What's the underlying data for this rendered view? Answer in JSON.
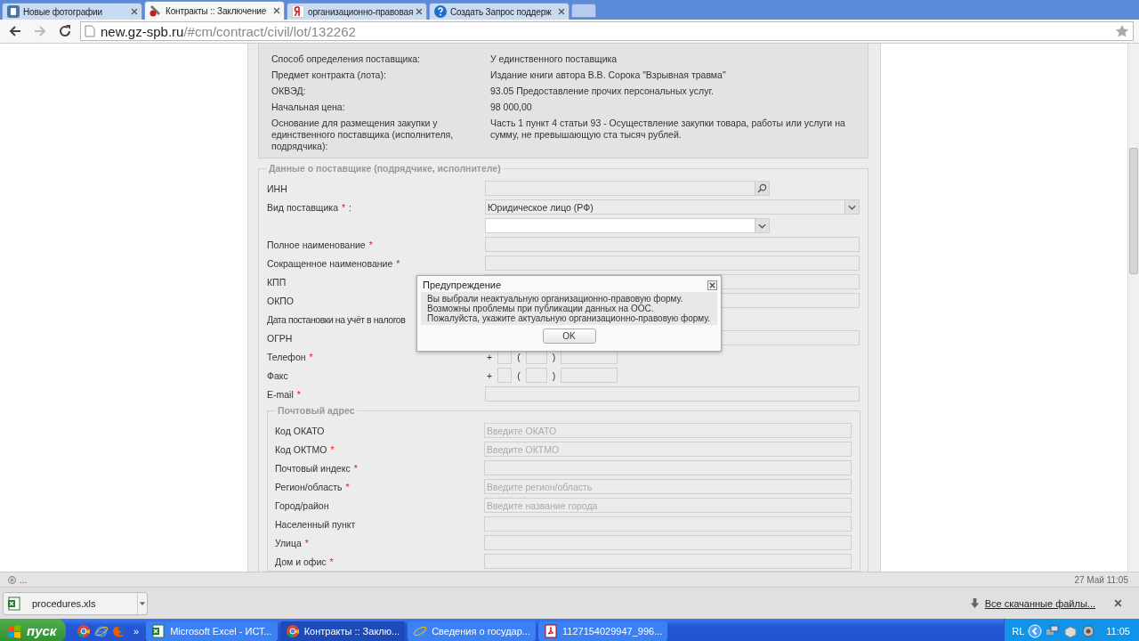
{
  "browser": {
    "tabs": [
      {
        "title": "Новые фотографии",
        "selected": false
      },
      {
        "title": "Контракты :: Заключение",
        "selected": true
      },
      {
        "title": "организационно-правовая",
        "selected": false
      },
      {
        "title": "Создать Запрос поддерж",
        "selected": false
      }
    ],
    "address": {
      "host": "new.gz-spb.ru",
      "path": "/#cm/contract/civil/lot/132262"
    }
  },
  "lot_info": [
    {
      "label": "Способ определения поставщика:",
      "value": "У единственного поставщика"
    },
    {
      "label": "Предмет контракта (лота):",
      "value": "Издание книги автора В.В. Сорока \"Взрывная травма\""
    },
    {
      "label": "ОКВЭД:",
      "value": "93.05 Предоставление прочих персональных услуг."
    },
    {
      "label": "Начальная цена:",
      "value": "98 000,00"
    },
    {
      "label": "Основание для размещения закупки у единственного поставщика (исполнителя, подрядчика):",
      "value": "Часть 1 пункт 4 статьи 93 - Осуществление закупки товара, работы или услуги на сумму, не превышающую ста тысяч рублей."
    }
  ],
  "supplier": {
    "legend": "Данные о поставщике (подрядчике, исполнителе)",
    "fields": [
      {
        "kind": "search",
        "label": "ИНН",
        "required": false
      },
      {
        "kind": "select",
        "label": "Вид поставщика",
        "required": true,
        "suffix": ":",
        "value": "Юридическое лицо (РФ)"
      },
      {
        "kind": "select_short"
      },
      {
        "kind": "text",
        "label": "Полное наименование",
        "required": true
      },
      {
        "kind": "text",
        "label": "Сокращенное наименование",
        "required": true
      },
      {
        "kind": "text",
        "label": "КПП",
        "required": false
      },
      {
        "kind": "text",
        "label": "ОКПО",
        "required": false
      },
      {
        "kind": "label_only",
        "label": "Дата постановки на учёт в налогов",
        "required": false
      },
      {
        "kind": "text",
        "label": "ОГРН",
        "required": false
      },
      {
        "kind": "phone",
        "label": "Телефон",
        "required": true,
        "plus": "+",
        "open": "(",
        "close": ")"
      },
      {
        "kind": "phone",
        "label": "Факс",
        "required": false,
        "plus": "+",
        "open": "(",
        "close": ")"
      },
      {
        "kind": "text",
        "label": "E-mail",
        "required": true
      }
    ]
  },
  "postal": {
    "legend": "Почтовый адрес",
    "fields": [
      {
        "label": "Код ОКАТО",
        "required": false,
        "placeholder": "Введите ОКАТО"
      },
      {
        "label": "Код ОКТМО",
        "required": true,
        "placeholder": "Введите ОКТМО"
      },
      {
        "label": "Почтовый индекс",
        "required": true
      },
      {
        "label": "Регион/область",
        "required": true,
        "placeholder": "Введите регион/область"
      },
      {
        "label": "Город/район",
        "required": false,
        "placeholder": "Введите название города"
      },
      {
        "label": "Населенный пункт",
        "required": false
      },
      {
        "label": "Улица",
        "required": true
      },
      {
        "label": "Дом и офис",
        "required": true
      }
    ]
  },
  "required_mark": "*",
  "dialog": {
    "title": "Предупреждение",
    "lines": [
      "Вы выбрали неактуальную организационно-правовую форму.",
      "Возможны проблемы при публикации данных на ООС.",
      "Пожалуйста, укажите актуальную организационно-правовую форму."
    ],
    "button": "OK"
  },
  "status": {
    "text": "...",
    "datetime": "27 Май 11:05"
  },
  "downloads": {
    "file": "procedures.xls",
    "link": "Все скачанные файлы..."
  },
  "taskbar": {
    "start": "пуск",
    "more": "»",
    "tasks": [
      {
        "title": "Microsoft Excel - ИСТ...",
        "selected": false
      },
      {
        "title": "Контракты :: Заклю...",
        "selected": true
      },
      {
        "title": "Сведения о государ...",
        "selected": false
      },
      {
        "title": "1127154029947_996...",
        "selected": false
      }
    ],
    "lang": "RL",
    "clock": "11:05"
  }
}
